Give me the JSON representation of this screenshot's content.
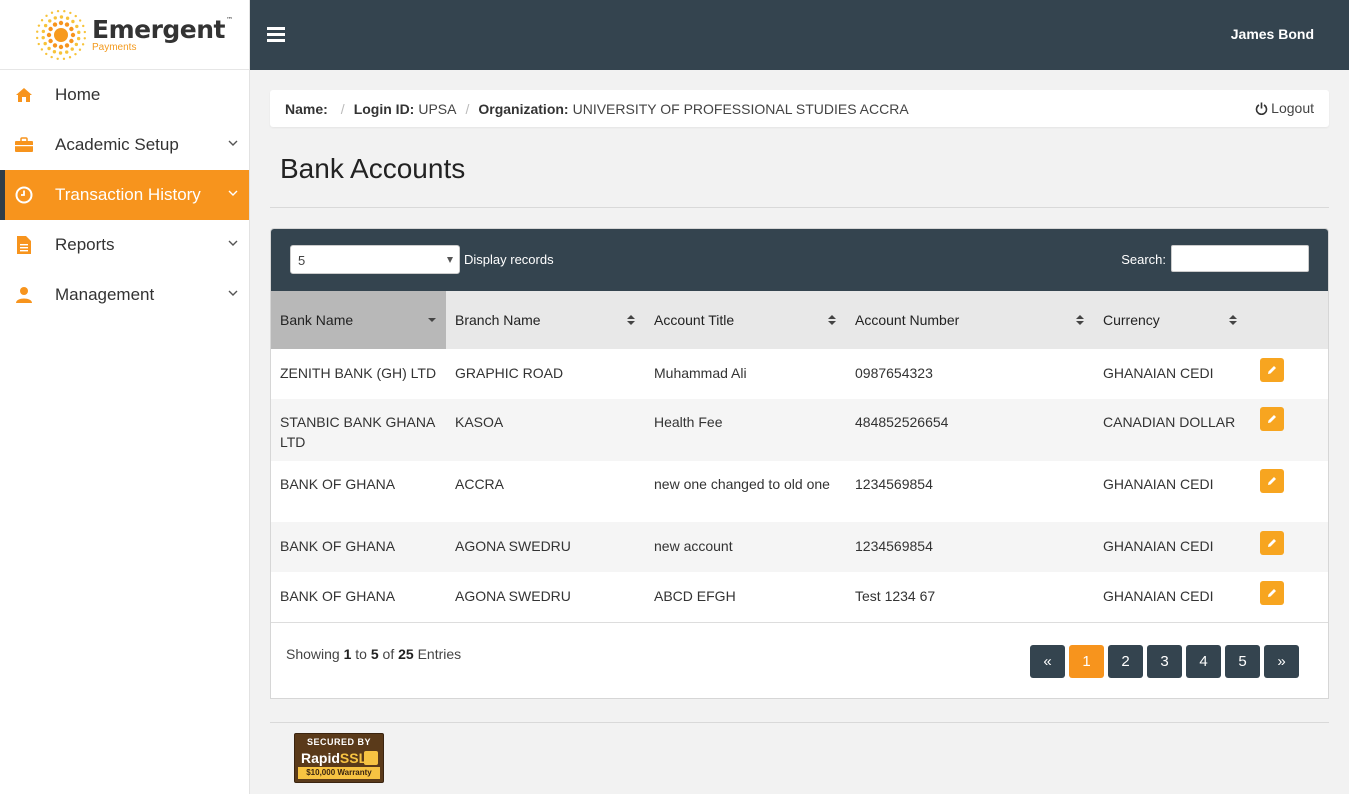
{
  "brand": {
    "name": "Emergent",
    "trademark": "™",
    "sub": "Payments"
  },
  "sidebar": {
    "items": [
      {
        "label": "Home",
        "icon": "home-icon",
        "active": false
      },
      {
        "label": "Academic Setup",
        "icon": "briefcase-icon",
        "active": false
      },
      {
        "label": "Transaction History",
        "icon": "clock-icon",
        "active": true
      },
      {
        "label": "Reports",
        "icon": "file-text-icon",
        "active": false
      },
      {
        "label": "Management",
        "icon": "user-icon",
        "active": false
      }
    ]
  },
  "header": {
    "user": "James Bond"
  },
  "breadcrumb": {
    "name_label": "Name:",
    "name_value": "",
    "login_label": "Login ID:",
    "login_value": "UPSA",
    "org_label": "Organization:",
    "org_value": "UNIVERSITY OF PROFESSIONAL STUDIES ACCRA",
    "logout": "Logout"
  },
  "page": {
    "title": "Bank Accounts"
  },
  "controls": {
    "page_size": "5",
    "display_label": "Display records",
    "search_label": "Search:",
    "search_value": ""
  },
  "table": {
    "columns": [
      "Bank Name",
      "Branch Name",
      "Account Title",
      "Account Number",
      "Currency"
    ],
    "rows": [
      [
        "ZENITH BANK (GH) LTD",
        "GRAPHIC ROAD",
        "Muhammad Ali",
        "0987654323",
        "GHANAIAN CEDI"
      ],
      [
        "STANBIC BANK GHANA LTD",
        "KASOA",
        "Health Fee",
        "484852526654",
        "CANADIAN DOLLAR"
      ],
      [
        "BANK OF GHANA",
        "ACCRA",
        "new one changed to old one",
        "1234569854",
        "GHANAIAN CEDI"
      ],
      [
        "BANK OF GHANA",
        "AGONA SWEDRU",
        "new account",
        "1234569854",
        "GHANAIAN CEDI"
      ],
      [
        "BANK OF GHANA",
        "AGONA SWEDRU",
        "ABCD EFGH",
        "Test 1234 67",
        "GHANAIAN CEDI"
      ]
    ]
  },
  "footer": {
    "showing_prefix": "Showing",
    "from": "1",
    "to_word": "to",
    "to": "5",
    "of_word": "of",
    "total": "25",
    "entries_word": "Entries",
    "pages": [
      "«",
      "1",
      "2",
      "3",
      "4",
      "5",
      "»"
    ],
    "current_page": "1"
  },
  "ssl": {
    "line1": "SECURED BY",
    "brand_a": "Rapid",
    "brand_b": "SSL.",
    "warranty": "$10,000 Warranty"
  },
  "colors": {
    "accent": "#f7941d",
    "dark": "#34444f",
    "edit": "#f7a520"
  }
}
